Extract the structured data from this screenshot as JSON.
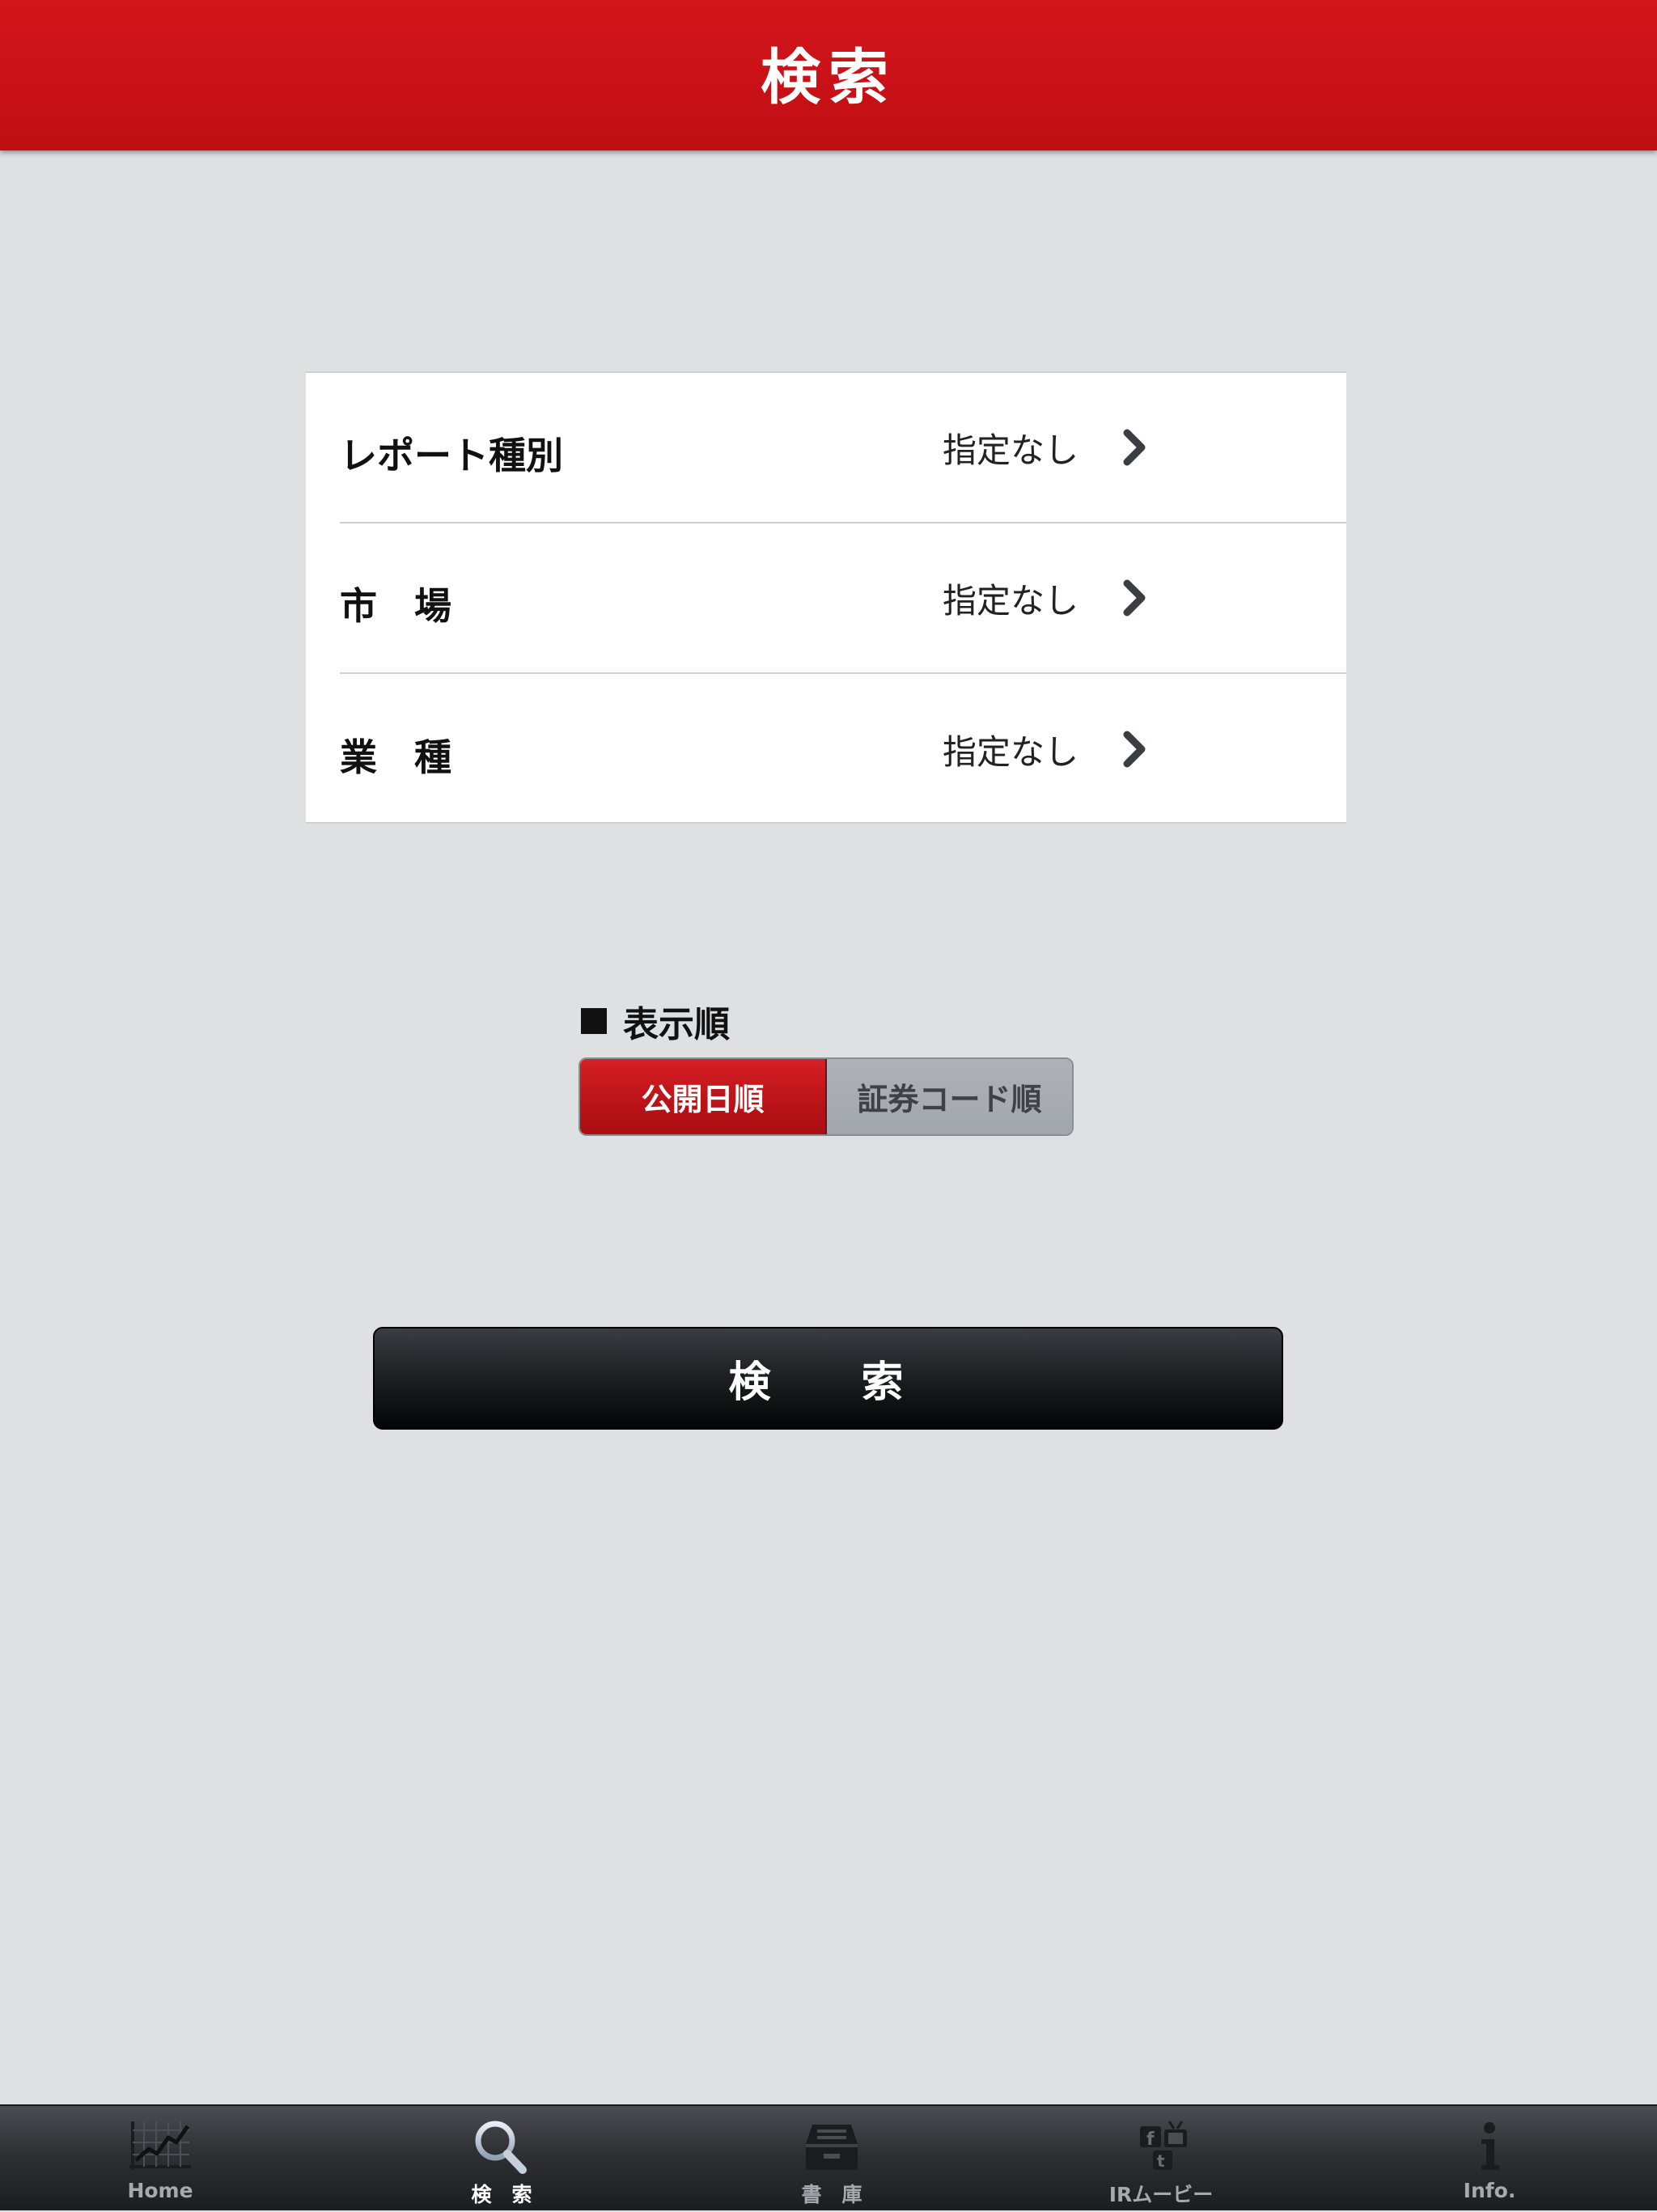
{
  "header": {
    "title": "検索"
  },
  "filters": [
    {
      "label": "レポート種別",
      "value": "指定なし"
    },
    {
      "label": "市　場",
      "value": "指定なし"
    },
    {
      "label": "業　種",
      "value": "指定なし"
    }
  ],
  "sort": {
    "label": "表示順",
    "options": [
      {
        "label": "公開日順",
        "selected": true
      },
      {
        "label": "証券コード順",
        "selected": false
      }
    ]
  },
  "search_button": {
    "label": "検　索"
  },
  "tabbar": {
    "items": [
      {
        "label": "Home",
        "icon": "chart-icon",
        "active": false
      },
      {
        "label": "検　索",
        "icon": "search-icon",
        "active": true
      },
      {
        "label": "書　庫",
        "icon": "archive-box-icon",
        "active": false
      },
      {
        "label": "IRムービー",
        "icon": "ir-movie-icon",
        "active": false
      },
      {
        "label": "Info.",
        "icon": "info-icon",
        "active": false
      }
    ]
  },
  "colors": {
    "header_red": "#c81117",
    "background": "#dfe0e2",
    "segment_active": "#bb1318",
    "segment_inactive": "#a6aab1",
    "button_dark": "#1c1e21",
    "tabbar_dark": "#2e3034"
  }
}
